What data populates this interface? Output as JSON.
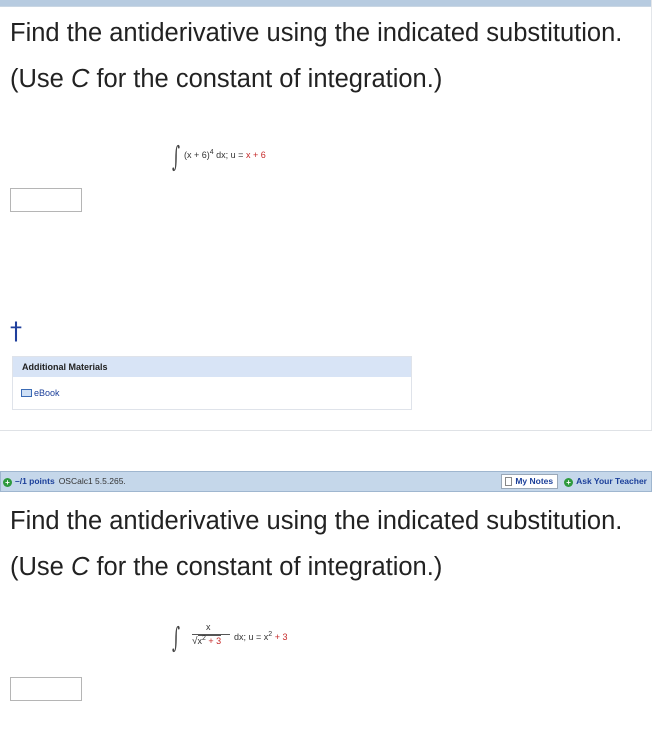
{
  "questions": [
    {
      "text_before": "Find the antiderivative using the indicated substitution. (Use ",
      "text_var": "C",
      "text_after": " for the constant of integration.)",
      "integral": {
        "integrand": "(x + 6)",
        "exponent": "4",
        "dx": " dx;  u = ",
        "sub_x": "x",
        "sub_rest": " + 6"
      }
    },
    {
      "text_before": "Find the antiderivative using the indicated substitution. (Use ",
      "text_var": "C",
      "text_after": " for the constant of integration.)",
      "integral": {
        "numerator": "x",
        "denominator_x": "x",
        "denominator_exp": "2",
        "denominator_rest": " + 3",
        "dx": "dx;  u = x",
        "sub_exp": "2",
        "sub_rest": " + 3"
      }
    }
  ],
  "footnote_marker": "†",
  "additional_materials": {
    "title": "Additional Materials",
    "ebook_label": "eBook"
  },
  "question_bar": {
    "points": "–/1 points",
    "source": "OSCalc1 5.5.265.",
    "my_notes": "My Notes",
    "ask_teacher": "Ask Your Teacher"
  },
  "icons": {
    "ebook": "book-icon",
    "notes": "note-icon",
    "expand": "plus-circle-icon",
    "ask": "plus-circle-icon"
  },
  "colors": {
    "accent_red": "#c62828",
    "link_blue": "#1b3f9a",
    "bar_bg": "#c5d7ea",
    "materials_head": "#d8e4f6"
  }
}
